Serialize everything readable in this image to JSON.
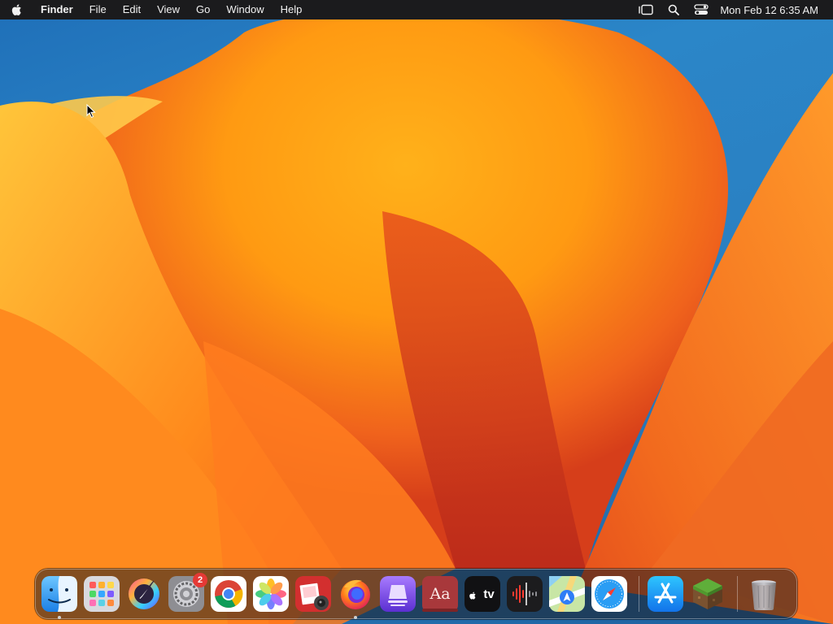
{
  "menubar": {
    "apple_icon": "apple-logo-icon",
    "app_name": "Finder",
    "menus": [
      "File",
      "Edit",
      "View",
      "Go",
      "Window",
      "Help"
    ],
    "status_icons": [
      "stage-manager-icon",
      "spotlight-search-icon",
      "control-center-icon"
    ],
    "clock": "Mon Feb 12  6:35 AM"
  },
  "dock": {
    "apps": [
      {
        "name": "Finder",
        "icon": "finder-icon",
        "running": true
      },
      {
        "name": "Launchpad",
        "icon": "launchpad-icon",
        "running": false
      },
      {
        "name": "Krita",
        "icon": "krita-icon",
        "running": false
      },
      {
        "name": "System Settings",
        "icon": "system-settings-icon",
        "running": false,
        "badge": "2"
      },
      {
        "name": "Google Chrome",
        "icon": "chrome-icon",
        "running": false
      },
      {
        "name": "Photos",
        "icon": "photos-icon",
        "running": false
      },
      {
        "name": "Photo Booth",
        "icon": "photo-booth-icon",
        "running": false
      },
      {
        "name": "Firefox",
        "icon": "firefox-icon",
        "running": true
      },
      {
        "name": "Podium",
        "icon": "purple-app-icon",
        "running": false
      },
      {
        "name": "Dictionary",
        "icon": "dictionary-icon",
        "running": false,
        "label": "Aa"
      },
      {
        "name": "Apple TV",
        "icon": "apple-tv-icon",
        "running": false,
        "label": "tv"
      },
      {
        "name": "Voice Memos",
        "icon": "voice-memos-icon",
        "running": false
      },
      {
        "name": "Maps",
        "icon": "maps-icon",
        "running": false
      },
      {
        "name": "Safari",
        "icon": "safari-icon",
        "running": false
      }
    ],
    "extras": [
      {
        "name": "App Store",
        "icon": "app-store-icon"
      },
      {
        "name": "Minecraft",
        "icon": "minecraft-icon"
      }
    ],
    "trash": {
      "name": "Trash",
      "icon": "trash-icon"
    }
  }
}
